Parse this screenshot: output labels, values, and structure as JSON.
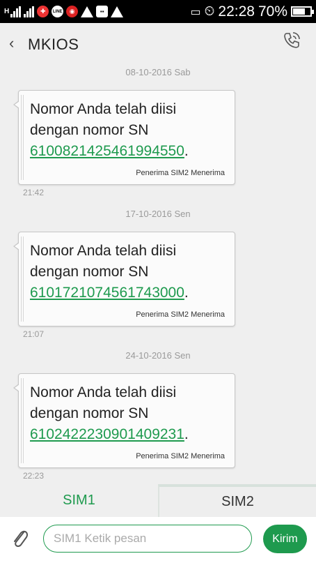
{
  "status_bar": {
    "network_label": "H",
    "time": "22:28",
    "battery": "70%",
    "battery_level": 0.7,
    "icons": [
      "signal-icon",
      "signal-icon",
      "gift-icon",
      "line-app-icon",
      "notification-icon",
      "warning-icon",
      "bbm-icon",
      "warning-icon",
      "sim-icon",
      "alarm-icon",
      "battery-icon"
    ]
  },
  "header": {
    "back_icon": "‹",
    "title": "MKIOS",
    "call_icon": "phone-icon"
  },
  "messages": [
    {
      "date": "08-10-2016 Sab",
      "text_line1": "Nomor Anda telah diisi",
      "text_line2": "dengan nomor SN",
      "sn": "6100821425461994550",
      "after_sn": ".",
      "received": "Penerima SIM2 Menerima",
      "time": "21:42"
    },
    {
      "date": "17-10-2016 Sen",
      "text_line1": "Nomor Anda telah diisi",
      "text_line2": "dengan nomor SN",
      "sn": "6101721074561743000",
      "after_sn": ".",
      "received": "Penerima SIM2 Menerima",
      "time": "21:07"
    },
    {
      "date": "24-10-2016 Sen",
      "text_line1": "Nomor Anda telah diisi",
      "text_line2": "dengan nomor SN",
      "sn": "6102422230901409231",
      "after_sn": ".",
      "received": "Penerima SIM2 Menerima",
      "time": "22:23"
    }
  ],
  "tabs": {
    "sim1": "SIM1",
    "sim2": "SIM2"
  },
  "compose": {
    "attach_icon": "paperclip-icon",
    "placeholder": "SIM1 Ketik pesan",
    "send_label": "Kirim"
  },
  "colors": {
    "accent": "#1e9a4e",
    "status_bar": "#000000",
    "background": "#efefef"
  }
}
